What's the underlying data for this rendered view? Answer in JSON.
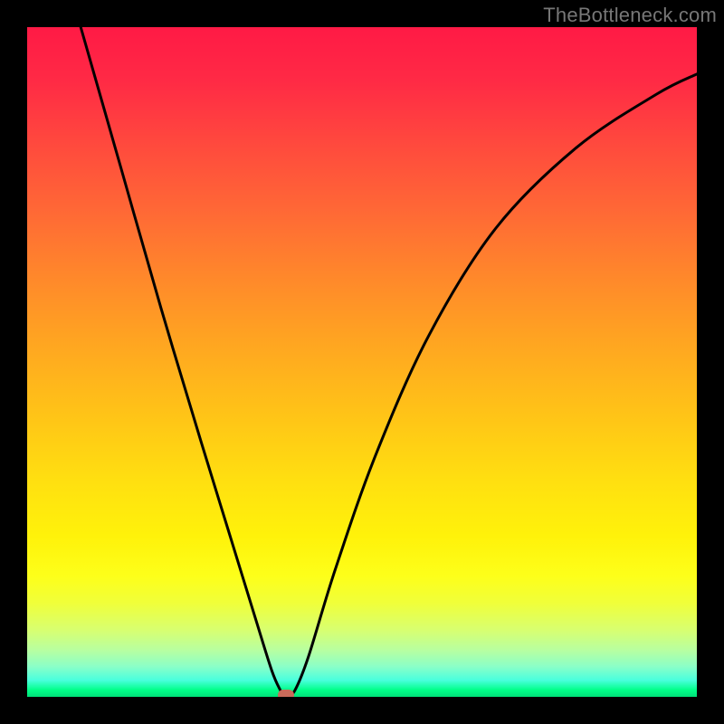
{
  "attribution": "TheBottleneck.com",
  "chart_data": {
    "type": "line",
    "title": "",
    "xlabel": "",
    "ylabel": "",
    "xlim": [
      0,
      100
    ],
    "ylim": [
      0,
      100
    ],
    "grid": false,
    "legend": false,
    "series": [
      {
        "name": "curve",
        "x": [
          8,
          14,
          20,
          26,
          30,
          34,
          36.5,
          37.8,
          38.4,
          39,
          40,
          42,
          46,
          52,
          60,
          70,
          82,
          94,
          100
        ],
        "y": [
          100,
          79,
          58,
          38,
          25,
          12,
          4,
          1,
          0.3,
          0.3,
          1,
          6,
          19,
          36,
          54,
          70,
          82,
          90,
          93
        ]
      }
    ],
    "marker": {
      "x": 38.7,
      "y": 0.3
    },
    "background_gradient_stops": [
      {
        "pct": 0,
        "color": "#ff1a45"
      },
      {
        "pct": 50,
        "color": "#ffc417"
      },
      {
        "pct": 82,
        "color": "#fdff1a"
      },
      {
        "pct": 100,
        "color": "#00e078"
      }
    ]
  }
}
